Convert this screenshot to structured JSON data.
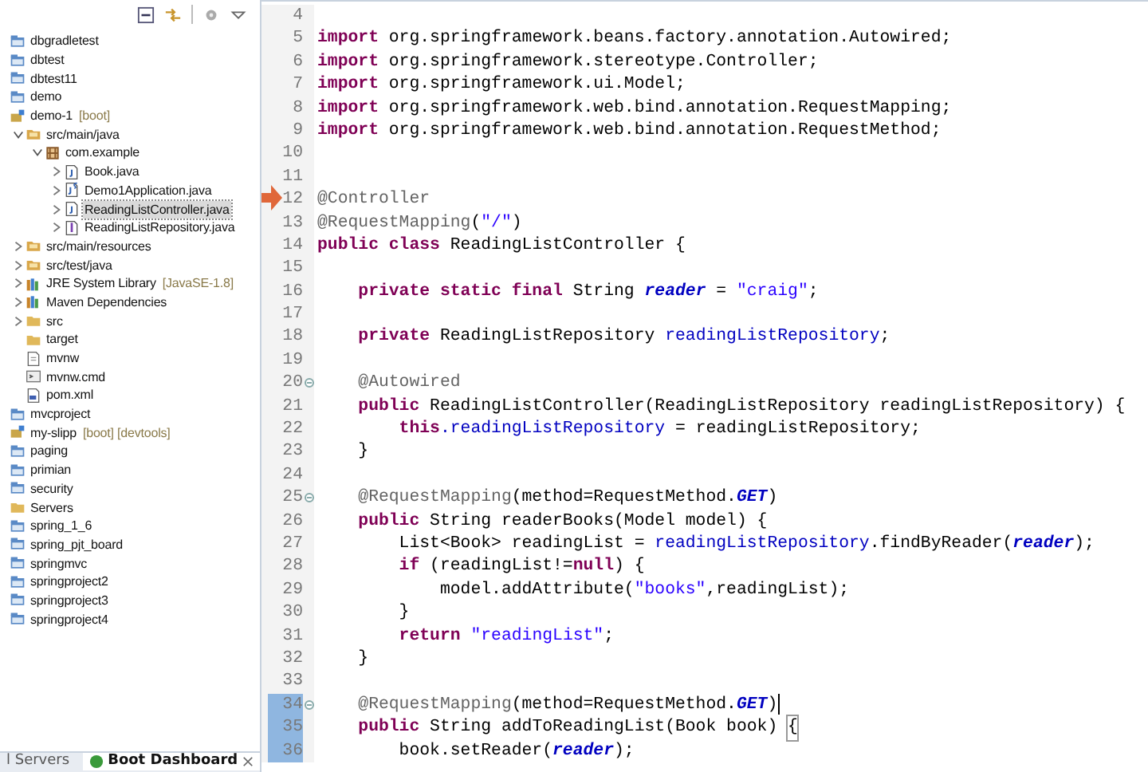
{
  "explorer": {
    "tree": [
      {
        "label": "dbgradletest",
        "kind": "project"
      },
      {
        "label": "dbtest",
        "kind": "project"
      },
      {
        "label": "dbtest11",
        "kind": "project"
      },
      {
        "label": "demo",
        "kind": "project"
      },
      {
        "label": "demo-1",
        "decoration": "[boot]",
        "kind": "boot-project",
        "children": [
          {
            "label": "src/main/java",
            "kind": "source-folder",
            "expanded": true,
            "children": [
              {
                "label": "com.example",
                "kind": "package",
                "expanded": true,
                "children": [
                  {
                    "label": "Book.java",
                    "kind": "java",
                    "expanded": false,
                    "selected": false
                  },
                  {
                    "label": "Demo1Application.java",
                    "kind": "boot-java",
                    "expanded": false,
                    "selected": false
                  },
                  {
                    "label": "ReadingListController.java",
                    "kind": "java",
                    "expanded": false,
                    "selected": true
                  },
                  {
                    "label": "ReadingListRepository.java",
                    "kind": "interface",
                    "expanded": false,
                    "selected": false
                  }
                ]
              }
            ]
          },
          {
            "label": "src/main/resources",
            "kind": "source-folder",
            "expanded": false
          },
          {
            "label": "src/test/java",
            "kind": "source-folder",
            "expanded": false
          },
          {
            "label": "JRE System Library",
            "decoration": "[JavaSE-1.8]",
            "kind": "library",
            "expanded": false
          },
          {
            "label": "Maven Dependencies",
            "kind": "library",
            "expanded": false
          },
          {
            "label": "src",
            "kind": "folder",
            "expanded": false
          },
          {
            "label": "target",
            "kind": "folder"
          },
          {
            "label": "mvnw",
            "kind": "file"
          },
          {
            "label": "mvnw.cmd",
            "kind": "cmd"
          },
          {
            "label": "pom.xml",
            "kind": "xml"
          }
        ]
      },
      {
        "label": "mvcproject",
        "kind": "project"
      },
      {
        "label": "my-slipp",
        "decoration": "[boot] [devtools]",
        "kind": "boot-project"
      },
      {
        "label": "paging",
        "kind": "project"
      },
      {
        "label": "primian",
        "kind": "project"
      },
      {
        "label": "security",
        "kind": "project"
      },
      {
        "label": "Servers",
        "kind": "folder"
      },
      {
        "label": "spring_1_6",
        "kind": "project"
      },
      {
        "label": "spring_pjt_board",
        "kind": "project"
      },
      {
        "label": "springmvc",
        "kind": "project"
      },
      {
        "label": "springproject2",
        "kind": "project"
      },
      {
        "label": "springproject3",
        "kind": "project"
      },
      {
        "label": "springproject4",
        "kind": "project"
      }
    ]
  },
  "bottom_tabs": [
    {
      "label": "l Servers",
      "selected": false
    },
    {
      "label": "Boot Dashboard",
      "selected": true
    }
  ],
  "editor": {
    "lines": [
      {
        "number": "4"
      },
      {
        "number": "5",
        "tokens": [
          {
            "text": "import",
            "kind": "kw"
          },
          {
            "text": " org.springframework.beans.factory.annotation.Autowired;",
            "kind": "plain"
          }
        ]
      },
      {
        "number": "6",
        "tokens": [
          {
            "text": "import",
            "kind": "kw"
          },
          {
            "text": " org.springframework.stereotype.Controller;",
            "kind": "plain"
          }
        ]
      },
      {
        "number": "7",
        "tokens": [
          {
            "text": "import",
            "kind": "kw"
          },
          {
            "text": " org.springframework.ui.Model;",
            "kind": "plain"
          }
        ]
      },
      {
        "number": "8",
        "tokens": [
          {
            "text": "import",
            "kind": "kw"
          },
          {
            "text": " org.springframework.web.bind.annotation.RequestMapping;",
            "kind": "plain"
          }
        ]
      },
      {
        "number": "9",
        "tokens": [
          {
            "text": "import",
            "kind": "kw"
          },
          {
            "text": " org.springframework.web.bind.annotation.RequestMethod;",
            "kind": "plain"
          }
        ]
      },
      {
        "number": "10"
      },
      {
        "number": "11"
      },
      {
        "number": "12",
        "tokens": [
          {
            "text": "@Controller",
            "kind": "ann"
          }
        ]
      },
      {
        "number": "13",
        "tokens": [
          {
            "text": "@RequestMapping",
            "kind": "ann"
          },
          {
            "text": "(",
            "kind": "plain"
          },
          {
            "text": "\"/\"",
            "kind": "str"
          },
          {
            "text": ")",
            "kind": "plain"
          }
        ]
      },
      {
        "number": "14",
        "tokens": [
          {
            "text": "public class",
            "kind": "kw"
          },
          {
            "text": " ReadingListController {",
            "kind": "plain"
          }
        ]
      },
      {
        "number": "15"
      },
      {
        "number": "16",
        "tokens": [
          {
            "text": "    private static final",
            "kind": "kw"
          },
          {
            "text": " String ",
            "kind": "plain"
          },
          {
            "text": "reader",
            "kind": "static"
          },
          {
            "text": " = ",
            "kind": "plain"
          },
          {
            "text": "\"craig\"",
            "kind": "str"
          },
          {
            "text": ";",
            "kind": "plain"
          }
        ]
      },
      {
        "number": "17"
      },
      {
        "number": "18",
        "tokens": [
          {
            "text": "    private",
            "kind": "kw"
          },
          {
            "text": " ReadingListRepository ",
            "kind": "plain"
          },
          {
            "text": "readingListRepository",
            "kind": "field"
          },
          {
            "text": ";",
            "kind": "plain"
          }
        ]
      },
      {
        "number": "19"
      },
      {
        "number": "20",
        "fold": true,
        "tokens": [
          {
            "text": "    @Autowired",
            "kind": "ann"
          }
        ]
      },
      {
        "number": "21",
        "tokens": [
          {
            "text": "    public",
            "kind": "kw"
          },
          {
            "text": " ReadingListController(ReadingListRepository readingListRepository) {",
            "kind": "plain"
          }
        ]
      },
      {
        "number": "22",
        "tokens": [
          {
            "text": "        this",
            "kind": "kw"
          },
          {
            "text": ".readingListRepository",
            "kind": "field"
          },
          {
            "text": " = readingListRepository;",
            "kind": "plain"
          }
        ]
      },
      {
        "number": "23",
        "tokens": [
          {
            "text": "    }",
            "kind": "plain"
          }
        ]
      },
      {
        "number": "24"
      },
      {
        "number": "25",
        "fold": true,
        "tokens": [
          {
            "text": "    @RequestMapping",
            "kind": "ann"
          },
          {
            "text": "(method=RequestMethod.",
            "kind": "plain"
          },
          {
            "text": "GET",
            "kind": "static"
          },
          {
            "text": ")",
            "kind": "plain"
          }
        ]
      },
      {
        "number": "26",
        "tokens": [
          {
            "text": "    public",
            "kind": "kw"
          },
          {
            "text": " String readerBooks(Model model) {",
            "kind": "plain"
          }
        ]
      },
      {
        "number": "27",
        "tokens": [
          {
            "text": "        List<Book> readingList = ",
            "kind": "plain"
          },
          {
            "text": "readingListRepository",
            "kind": "field"
          },
          {
            "text": ".findByReader(",
            "kind": "plain"
          },
          {
            "text": "reader",
            "kind": "static"
          },
          {
            "text": ");",
            "kind": "plain"
          }
        ]
      },
      {
        "number": "28",
        "tokens": [
          {
            "text": "        if",
            "kind": "kw"
          },
          {
            "text": " (readingList!=",
            "kind": "plain"
          },
          {
            "text": "null",
            "kind": "kw"
          },
          {
            "text": ") {",
            "kind": "plain"
          }
        ]
      },
      {
        "number": "29",
        "tokens": [
          {
            "text": "            model.addAttribute(",
            "kind": "plain"
          },
          {
            "text": "\"books\"",
            "kind": "str"
          },
          {
            "text": ",readingList);",
            "kind": "plain"
          }
        ]
      },
      {
        "number": "30",
        "tokens": [
          {
            "text": "        }",
            "kind": "plain"
          }
        ]
      },
      {
        "number": "31",
        "tokens": [
          {
            "text": "        return ",
            "kind": "kw"
          },
          {
            "text": "\"readingList\"",
            "kind": "str"
          },
          {
            "text": ";",
            "kind": "plain"
          }
        ]
      },
      {
        "number": "32",
        "tokens": [
          {
            "text": "    }",
            "kind": "plain"
          }
        ]
      },
      {
        "number": "33"
      },
      {
        "number": "34",
        "fold": true,
        "changed": true,
        "cursor": true,
        "tokens": [
          {
            "text": "    @RequestMapping",
            "kind": "ann"
          },
          {
            "text": "(method=RequestMethod.",
            "kind": "plain"
          },
          {
            "text": "GET",
            "kind": "static"
          },
          {
            "text": ")",
            "kind": "plain"
          }
        ]
      },
      {
        "number": "35",
        "changed": true,
        "tokens": [
          {
            "text": "    public",
            "kind": "kw"
          },
          {
            "text": " String addToReadingList(Book book) ",
            "kind": "plain"
          },
          {
            "text": "{",
            "kind": "bracket-match"
          }
        ]
      },
      {
        "number": "36",
        "changed": true,
        "tokens": [
          {
            "text": "        book.setReader(",
            "kind": "plain"
          },
          {
            "text": "reader",
            "kind": "static"
          },
          {
            "text": ");",
            "kind": "plain"
          }
        ]
      }
    ]
  }
}
